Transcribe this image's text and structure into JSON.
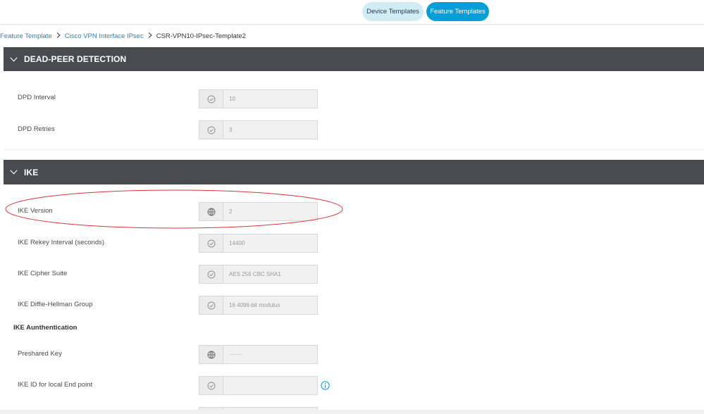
{
  "header": {
    "tabs": [
      {
        "label": "Device Templates"
      },
      {
        "label": "Feature Templates"
      }
    ]
  },
  "breadcrumb": {
    "items": [
      "Feature Template",
      "Cisco VPN Interface IPsec"
    ],
    "current": "CSR-VPN10-IPsec-Template2"
  },
  "sections": {
    "dpd": {
      "title": "DEAD-PEER DETECTION",
      "rows": [
        {
          "label": "DPD Interval",
          "value": "10",
          "scope_icon": "check-circle-icon"
        },
        {
          "label": "DPD Retries",
          "value": "3",
          "scope_icon": "check-circle-icon"
        }
      ]
    },
    "ike": {
      "title": "IKE",
      "rows": [
        {
          "label": "IKE Version",
          "value": "2",
          "scope_icon": "globe-icon"
        },
        {
          "label": "IKE Rekey Interval (seconds)",
          "value": "14400",
          "scope_icon": "check-circle-icon"
        },
        {
          "label": "IKE Cipher Suite",
          "value": "AES 256 CBC SHA1",
          "scope_icon": "check-circle-icon"
        },
        {
          "label": "IKE Diffie-Hellman Group",
          "value": "16 4096-bit modulus",
          "scope_icon": "check-circle-icon"
        }
      ],
      "auth": {
        "title": "IKE Aunthentication",
        "rows": [
          {
            "label": "Preshared Key",
            "value": "·······",
            "scope_icon": "globe-icon"
          },
          {
            "label": "IKE ID for local End point",
            "value": "",
            "scope_icon": "check-circle-icon"
          }
        ]
      }
    }
  },
  "colors": {
    "section_header": "#4a4b50",
    "tab_active": "#049fd9",
    "tab_inactive": "#d2ecf5",
    "link": "#2b85c1",
    "highlight_ellipse": "#d9343a"
  }
}
